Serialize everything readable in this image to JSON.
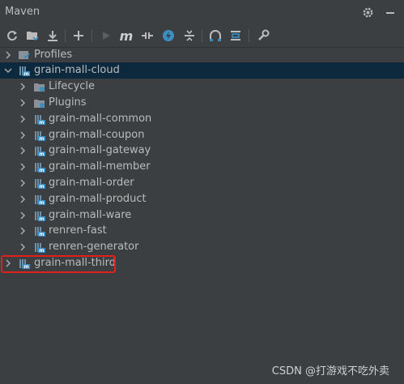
{
  "window": {
    "title": "Maven"
  },
  "toolbar": {
    "buttons": [
      "reload-icon",
      "add-project-icon",
      "download-icon",
      "plus-icon",
      "run-icon",
      "maven-goal-icon",
      "toggle-offline-icon",
      "skip-tests-icon",
      "collapse-icon",
      "show-dependencies-icon",
      "collapse-all-icon",
      "settings-wrench-icon"
    ]
  },
  "tree": {
    "profiles": "Profiles",
    "root": "grain-mall-cloud",
    "lifecycle": "Lifecycle",
    "plugins": "Plugins",
    "modules": [
      "grain-mall-common",
      "grain-mall-coupon",
      "grain-mall-gateway",
      "grain-mall-member",
      "grain-mall-order",
      "grain-mall-product",
      "grain-mall-ware",
      "renren-fast",
      "renren-generator"
    ],
    "third": "grain-mall-third"
  },
  "watermark": "CSDN @打游戏不吃外卖",
  "colors": {
    "selection": "#0d293e",
    "highlight": "#e0201b",
    "accent": "#4aa8d8"
  }
}
